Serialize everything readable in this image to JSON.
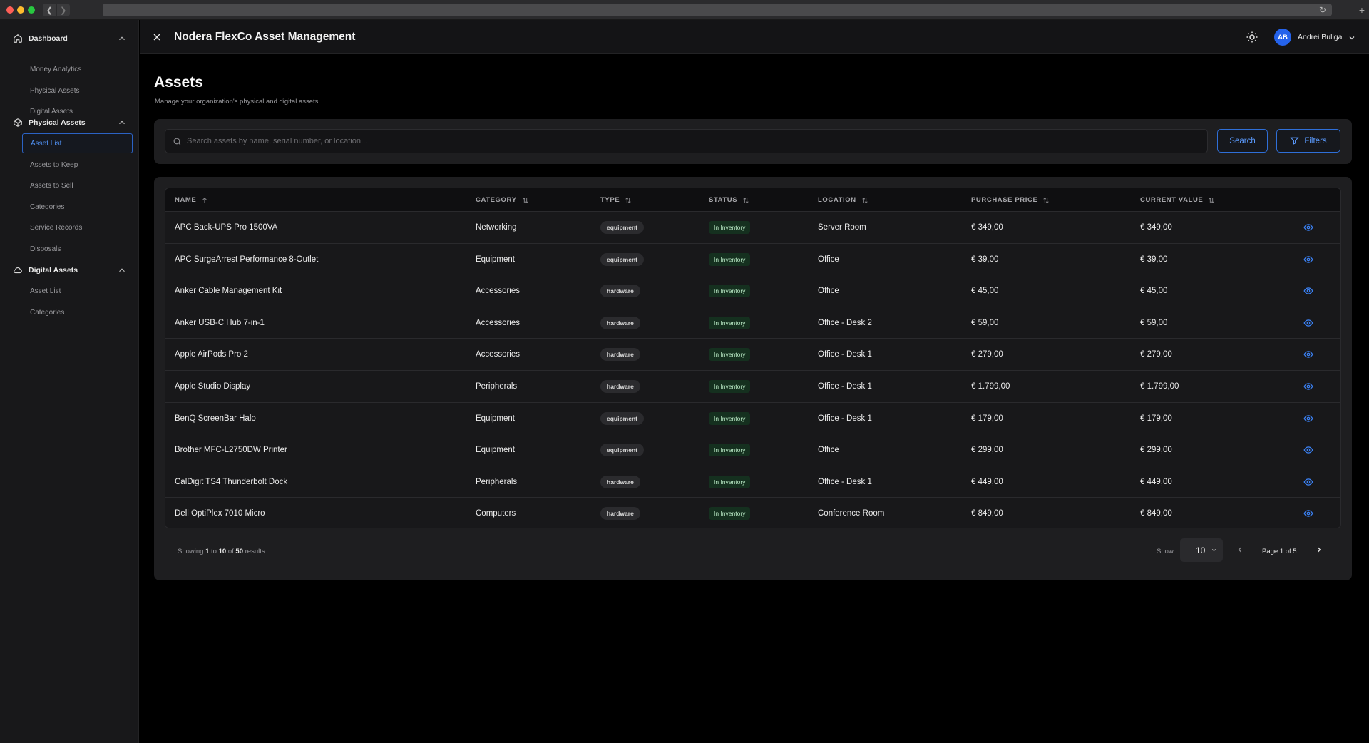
{
  "browser": {
    "reload_icon": "reload-icon",
    "newtab_icon": "plus-icon"
  },
  "header": {
    "title": "Nodera FlexCo Asset Management",
    "user_initials": "AB",
    "user_name": "Andrei Buliga"
  },
  "sidebar": {
    "sections": [
      {
        "label": "Dashboard",
        "icon": "home-icon",
        "items": [
          "Money Analytics",
          "Physical Assets",
          "Digital Assets"
        ]
      },
      {
        "label": "Physical Assets",
        "icon": "box-icon",
        "items": [
          "Asset List",
          "Assets to Keep",
          "Assets to Sell",
          "Categories",
          "Service Records",
          "Disposals"
        ]
      },
      {
        "label": "Digital Assets",
        "icon": "cloud-icon",
        "items": [
          "Asset List",
          "Categories"
        ]
      }
    ],
    "active_item": "Physical Assets / Asset List"
  },
  "page": {
    "title": "Assets",
    "subtitle": "Manage your organization's physical and digital assets"
  },
  "search": {
    "placeholder": "Search assets by name, serial number, or location...",
    "search_label": "Search",
    "filters_label": "Filters"
  },
  "table": {
    "columns": [
      "NAME",
      "CATEGORY",
      "TYPE",
      "STATUS",
      "LOCATION",
      "PURCHASE PRICE",
      "CURRENT VALUE"
    ],
    "rows": [
      {
        "name": "APC Back-UPS Pro 1500VA",
        "category": "Networking",
        "type": "equipment",
        "status": "In Inventory",
        "location": "Server Room",
        "purchase": "€ 349,00",
        "current": "€ 349,00"
      },
      {
        "name": "APC SurgeArrest Performance 8-Outlet",
        "category": "Equipment",
        "type": "equipment",
        "status": "In Inventory",
        "location": "Office",
        "purchase": "€ 39,00",
        "current": "€ 39,00"
      },
      {
        "name": "Anker Cable Management Kit",
        "category": "Accessories",
        "type": "hardware",
        "status": "In Inventory",
        "location": "Office",
        "purchase": "€ 45,00",
        "current": "€ 45,00"
      },
      {
        "name": "Anker USB-C Hub 7-in-1",
        "category": "Accessories",
        "type": "hardware",
        "status": "In Inventory",
        "location": "Office - Desk 2",
        "purchase": "€ 59,00",
        "current": "€ 59,00"
      },
      {
        "name": "Apple AirPods Pro 2",
        "category": "Accessories",
        "type": "hardware",
        "status": "In Inventory",
        "location": "Office - Desk 1",
        "purchase": "€ 279,00",
        "current": "€ 279,00"
      },
      {
        "name": "Apple Studio Display",
        "category": "Peripherals",
        "type": "hardware",
        "status": "In Inventory",
        "location": "Office - Desk 1",
        "purchase": "€ 1.799,00",
        "current": "€ 1.799,00"
      },
      {
        "name": "BenQ ScreenBar Halo",
        "category": "Equipment",
        "type": "equipment",
        "status": "In Inventory",
        "location": "Office - Desk 1",
        "purchase": "€ 179,00",
        "current": "€ 179,00"
      },
      {
        "name": "Brother MFC-L2750DW Printer",
        "category": "Equipment",
        "type": "equipment",
        "status": "In Inventory",
        "location": "Office",
        "purchase": "€ 299,00",
        "current": "€ 299,00"
      },
      {
        "name": "CalDigit TS4 Thunderbolt Dock",
        "category": "Peripherals",
        "type": "hardware",
        "status": "In Inventory",
        "location": "Office - Desk 1",
        "purchase": "€ 449,00",
        "current": "€ 449,00"
      },
      {
        "name": "Dell OptiPlex 7010 Micro",
        "category": "Computers",
        "type": "hardware",
        "status": "In Inventory",
        "location": "Conference Room",
        "purchase": "€ 849,00",
        "current": "€ 849,00"
      }
    ]
  },
  "pagination": {
    "showing_prefix": "Showing",
    "from": "1",
    "to_word": "to",
    "to": "10",
    "of_word": "of",
    "total": "50",
    "results_word": "results",
    "show_label": "Show:",
    "page_size": "10",
    "page_label": "Page 1 of 5"
  },
  "colors": {
    "accent": "#2563eb",
    "status_bg": "#15301f",
    "background": "#000000"
  }
}
